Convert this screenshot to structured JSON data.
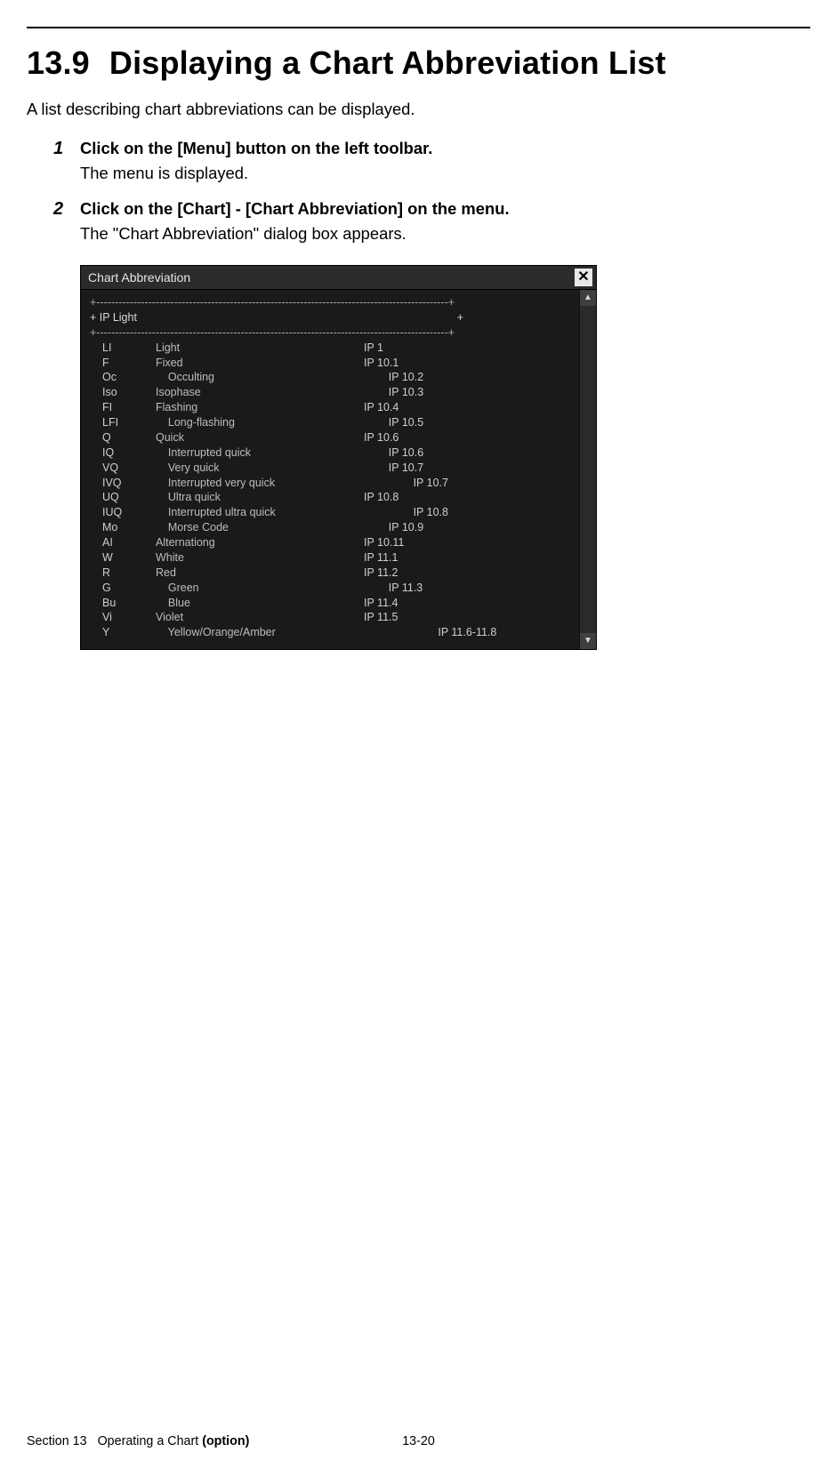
{
  "heading_number": "13.9",
  "heading_text": "Displaying a Chart Abbreviation List",
  "intro": "A list describing chart abbreviations can be displayed.",
  "steps": [
    {
      "num": "1",
      "title": "Click on the [Menu] button on the left toolbar.",
      "body": "The menu is displayed."
    },
    {
      "num": "2",
      "title": "Click on the [Chart] - [Chart Abbreviation] on the menu.",
      "body": "The \"Chart Abbreviation\" dialog box appears."
    }
  ],
  "dialog": {
    "title": "Chart Abbreviation",
    "dashed_line": "+-----------------------------------------------------------------------------------------------+",
    "section_header_left": "+ IP  Light",
    "section_header_right": "+",
    "rows": [
      {
        "abbr": "LI",
        "indent": 0,
        "term": "Light",
        "code_indent": 0,
        "code": "IP 1"
      },
      {
        "abbr": "F",
        "indent": 0,
        "term": "Fixed",
        "code_indent": 0,
        "code": "IP 10.1"
      },
      {
        "abbr": "Oc",
        "indent": 1,
        "term": "Occulting",
        "code_indent": 2,
        "code": "IP 10.2"
      },
      {
        "abbr": "Iso",
        "indent": 0,
        "term": "Isophase",
        "code_indent": 2,
        "code": "IP 10.3"
      },
      {
        "abbr": "FI",
        "indent": 0,
        "term": "Flashing",
        "code_indent": 0,
        "code": "IP 10.4"
      },
      {
        "abbr": "LFI",
        "indent": 1,
        "term": "Long-flashing",
        "code_indent": 2,
        "code": "IP 10.5"
      },
      {
        "abbr": "Q",
        "indent": 0,
        "term": "Quick",
        "code_indent": 0,
        "code": "IP 10.6"
      },
      {
        "abbr": "IQ",
        "indent": 1,
        "term": "Interrupted quick",
        "code_indent": 2,
        "code": "IP 10.6"
      },
      {
        "abbr": "VQ",
        "indent": 1,
        "term": "Very quick",
        "code_indent": 2,
        "code": "IP 10.7"
      },
      {
        "abbr": "IVQ",
        "indent": 1,
        "term": "Interrupted very quick",
        "code_indent": 4,
        "code": "IP 10.7"
      },
      {
        "abbr": "UQ",
        "indent": 1,
        "term": "Ultra quick",
        "code_indent": 0,
        "code": "IP 10.8"
      },
      {
        "abbr": "IUQ",
        "indent": 1,
        "term": "Interrupted ultra quick",
        "code_indent": 4,
        "code": "IP 10.8"
      },
      {
        "abbr": "Mo",
        "indent": 1,
        "term": "Morse Code",
        "code_indent": 2,
        "code": "IP 10.9"
      },
      {
        "abbr": "AI",
        "indent": 0,
        "term": "Alternationg",
        "code_indent": 0,
        "code": "IP 10.11"
      },
      {
        "abbr": "W",
        "indent": 0,
        "term": "White",
        "code_indent": 0,
        "code": "IP 11.1"
      },
      {
        "abbr": "R",
        "indent": 0,
        "term": "Red",
        "code_indent": 0,
        "code": "IP 11.2"
      },
      {
        "abbr": "G",
        "indent": 1,
        "term": "Green",
        "code_indent": 2,
        "code": "IP 11.3"
      },
      {
        "abbr": "Bu",
        "indent": 1,
        "term": "Blue",
        "code_indent": 0,
        "code": "IP 11.4"
      },
      {
        "abbr": "Vi",
        "indent": 0,
        "term": "Violet",
        "code_indent": 0,
        "code": "IP 11.5"
      },
      {
        "abbr": "Y",
        "indent": 1,
        "term": "Yellow/Orange/Amber",
        "code_indent": 6,
        "code": "IP 11.6-11.8"
      }
    ]
  },
  "footer": {
    "section_label": "Section 13",
    "section_title_plain": "Operating a Chart ",
    "section_title_bold": "(option)",
    "page_number": "13-20"
  }
}
